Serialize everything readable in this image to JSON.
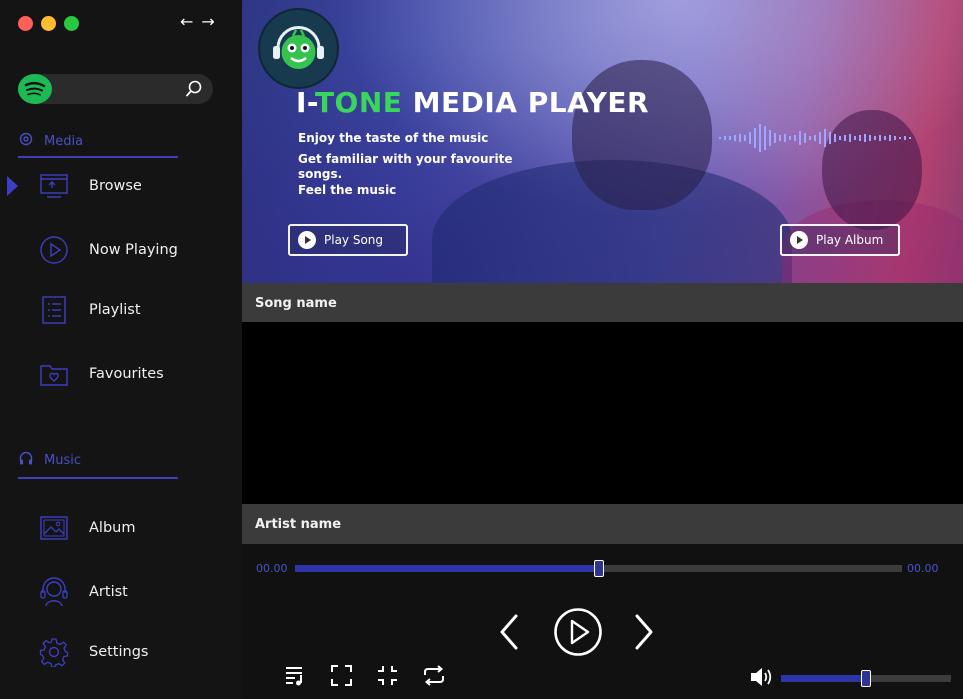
{
  "window": {
    "back_arrow": "←",
    "forward_arrow": "→"
  },
  "search": {
    "placeholder": "",
    "value": ""
  },
  "sidebar": {
    "sections": [
      {
        "label": "Media"
      },
      {
        "label": "Music"
      }
    ],
    "media_items": [
      {
        "label": "Browse",
        "icon": "browse-icon",
        "active": true
      },
      {
        "label": "Now Playing",
        "icon": "play-circle-icon"
      },
      {
        "label": "Playlist",
        "icon": "list-icon"
      },
      {
        "label": "Favourites",
        "icon": "heart-folder-icon"
      }
    ],
    "music_items": [
      {
        "label": "Album",
        "icon": "image-icon"
      },
      {
        "label": "Artist",
        "icon": "headset-user-icon"
      },
      {
        "label": "Settings",
        "icon": "gear-icon"
      }
    ]
  },
  "banner": {
    "title_prefix": "I-",
    "title_accent": "TONE",
    "title_suffix": " MEDIA PLAYER",
    "lines": [
      "Enjoy the taste of the music",
      "Get familiar with your favourite",
      "songs.",
      "Feel the music"
    ],
    "play_song": "Play Song",
    "play_album": "Play Album"
  },
  "player": {
    "song_name": "Song name",
    "artist_name": "Artist name",
    "time_current": "00.00",
    "time_total": "00.00",
    "progress_fraction": 0.5,
    "volume_fraction": 0.5
  },
  "colors": {
    "accent": "#3d3fc2",
    "accent_green": "#38d65a",
    "bar": "#3b3b3b",
    "sidebar": "#141414",
    "spotify": "#1db954"
  }
}
